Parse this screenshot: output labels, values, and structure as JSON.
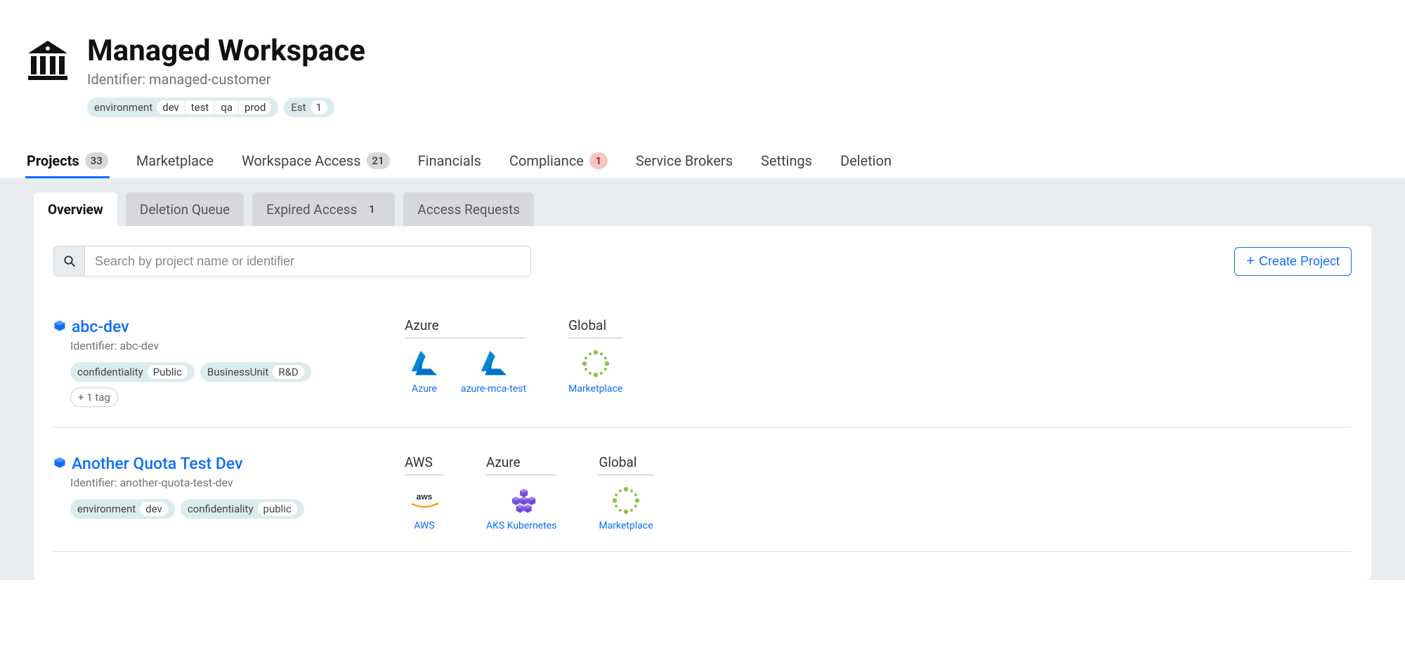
{
  "header": {
    "title": "Managed Workspace",
    "identifier_label": "Identifier: managed-customer",
    "tags": [
      {
        "key": "environment",
        "values": [
          "dev",
          "test",
          "qa",
          "prod"
        ]
      },
      {
        "key": "Est",
        "values": [
          "1"
        ]
      }
    ]
  },
  "nav": [
    {
      "label": "Projects",
      "badge": "33",
      "active": true
    },
    {
      "label": "Marketplace"
    },
    {
      "label": "Workspace Access",
      "badge": "21"
    },
    {
      "label": "Financials"
    },
    {
      "label": "Compliance",
      "badge": "1",
      "badgeWarn": true
    },
    {
      "label": "Service Brokers"
    },
    {
      "label": "Settings"
    },
    {
      "label": "Deletion"
    }
  ],
  "subtabs": [
    {
      "label": "Overview",
      "active": true
    },
    {
      "label": "Deletion Queue"
    },
    {
      "label": "Expired Access",
      "badge": "1"
    },
    {
      "label": "Access Requests"
    }
  ],
  "search": {
    "placeholder": "Search by project name or identifier"
  },
  "create_button": "Create Project",
  "projects": [
    {
      "name": "abc-dev",
      "identifier": "Identifier: abc-dev",
      "tags": [
        {
          "key": "confidentiality",
          "value": "Public"
        },
        {
          "key": "BusinessUnit",
          "value": "R&D"
        }
      ],
      "extra_tags_label": "+ 1 tag",
      "platforms": [
        {
          "group": "Azure",
          "items": [
            {
              "icon": "azure",
              "label": "Azure"
            },
            {
              "icon": "azure",
              "label": "azure-mca-test"
            }
          ]
        },
        {
          "group": "Global",
          "items": [
            {
              "icon": "marketplace",
              "label": "Marketplace"
            }
          ]
        }
      ]
    },
    {
      "name": "Another Quota Test Dev",
      "identifier": "Identifier: another-quota-test-dev",
      "tags": [
        {
          "key": "environment",
          "value": "dev"
        },
        {
          "key": "confidentiality",
          "value": "public"
        }
      ],
      "platforms": [
        {
          "group": "AWS",
          "items": [
            {
              "icon": "aws",
              "label": "AWS"
            }
          ]
        },
        {
          "group": "Azure",
          "items": [
            {
              "icon": "aks",
              "label": "AKS Kubernetes"
            }
          ]
        },
        {
          "group": "Global",
          "items": [
            {
              "icon": "marketplace",
              "label": "Marketplace"
            }
          ]
        }
      ]
    }
  ]
}
